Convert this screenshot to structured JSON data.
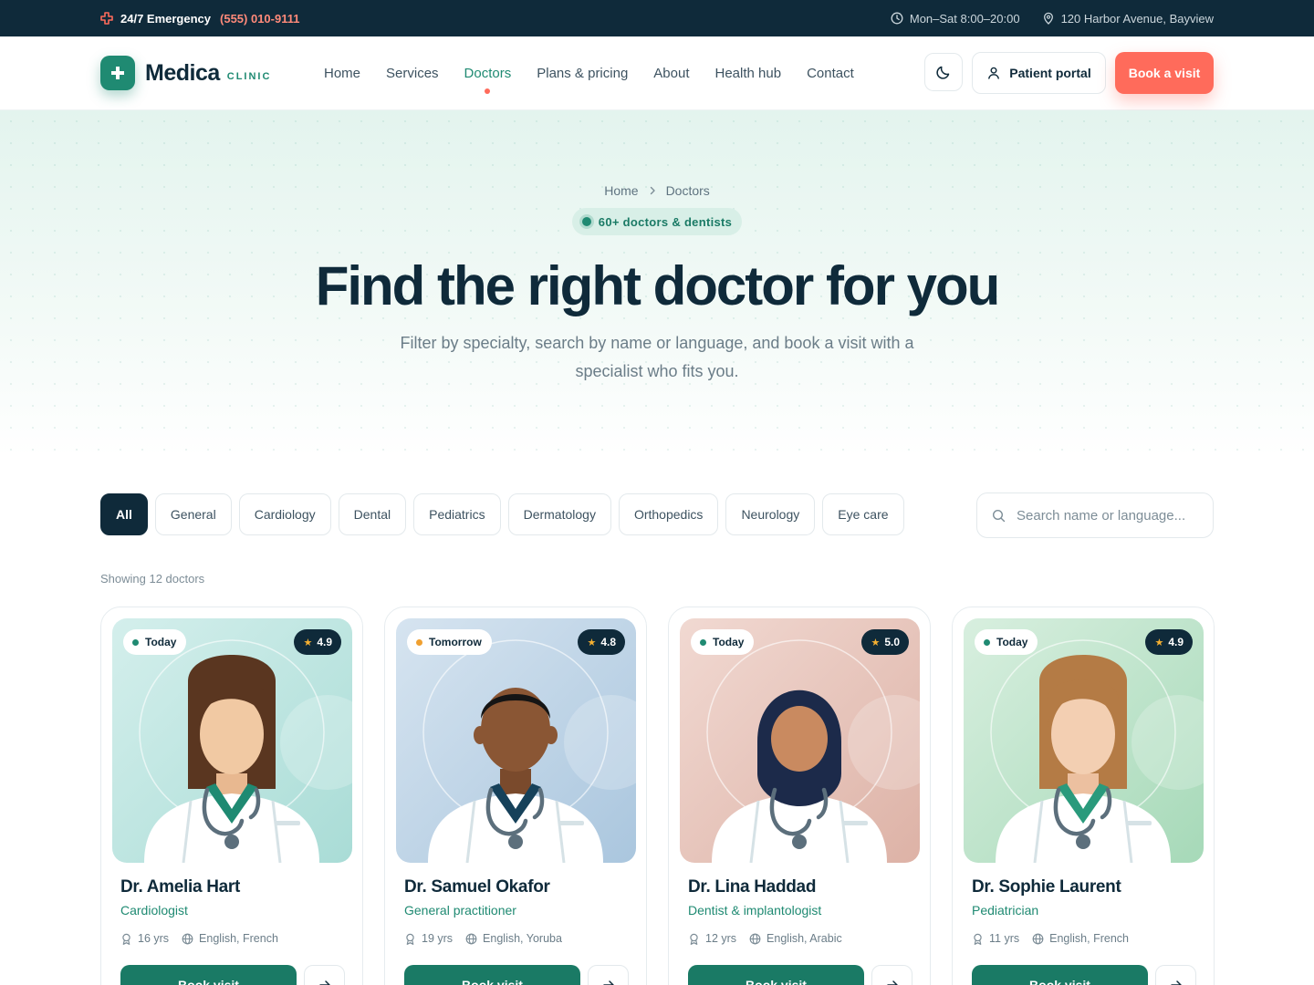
{
  "topbar": {
    "emergency_label": "24/7 Emergency",
    "emergency_phone": "(555) 010-9111",
    "hours": "Mon–Sat 8:00–20:00",
    "address": "120 Harbor Avenue, Bayview"
  },
  "brand": {
    "name": "Medica",
    "tag": "CLINIC",
    "accent": "#1f8a72",
    "cta": "#ff6b5b",
    "dark": "#0f2a3a"
  },
  "nav": {
    "items": [
      {
        "label": "Home"
      },
      {
        "label": "Services"
      },
      {
        "label": "Doctors",
        "active": true
      },
      {
        "label": "Plans & pricing"
      },
      {
        "label": "About"
      },
      {
        "label": "Health hub"
      },
      {
        "label": "Contact"
      }
    ],
    "theme_icon": "moon-icon",
    "portal_label": "Patient portal",
    "book_label": "Book a visit"
  },
  "hero": {
    "breadcrumb": [
      "Home",
      "Doctors"
    ],
    "badge": "60+ doctors & dentists",
    "title": "Find the right doctor for you",
    "subtitle": "Filter by specialty, search by name or language, and book a visit with a specialist who fits you."
  },
  "filters": {
    "chips": [
      "All",
      "General",
      "Cardiology",
      "Dental",
      "Pediatrics",
      "Dermatology",
      "Orthopedics",
      "Neurology",
      "Eye care"
    ],
    "active": "All",
    "search_placeholder": "Search name or language..."
  },
  "results": {
    "showing": "Showing 12 doctors"
  },
  "doctors": [
    {
      "name": "Dr. Amelia Hart",
      "specialty": "Cardiologist",
      "experience": "16 yrs",
      "languages": "English, French",
      "availability": "Today",
      "availability_color": "#1f8a72",
      "rating": "4.9",
      "book_label": "Book visit"
    },
    {
      "name": "Dr. Samuel Okafor",
      "specialty": "General practitioner",
      "experience": "19 yrs",
      "languages": "English, Yoruba",
      "availability": "Tomorrow",
      "availability_color": "#f0a030",
      "rating": "4.8",
      "book_label": "Book visit"
    },
    {
      "name": "Dr. Lina Haddad",
      "specialty": "Dentist & implantologist",
      "experience": "12 yrs",
      "languages": "English, Arabic",
      "availability": "Today",
      "availability_color": "#1f8a72",
      "rating": "5.0",
      "book_label": "Book visit"
    },
    {
      "name": "Dr. Sophie Laurent",
      "specialty": "Pediatrician",
      "experience": "11 yrs",
      "languages": "English, French",
      "availability": "Today",
      "availability_color": "#1f8a72",
      "rating": "4.9",
      "book_label": "Book visit"
    }
  ]
}
